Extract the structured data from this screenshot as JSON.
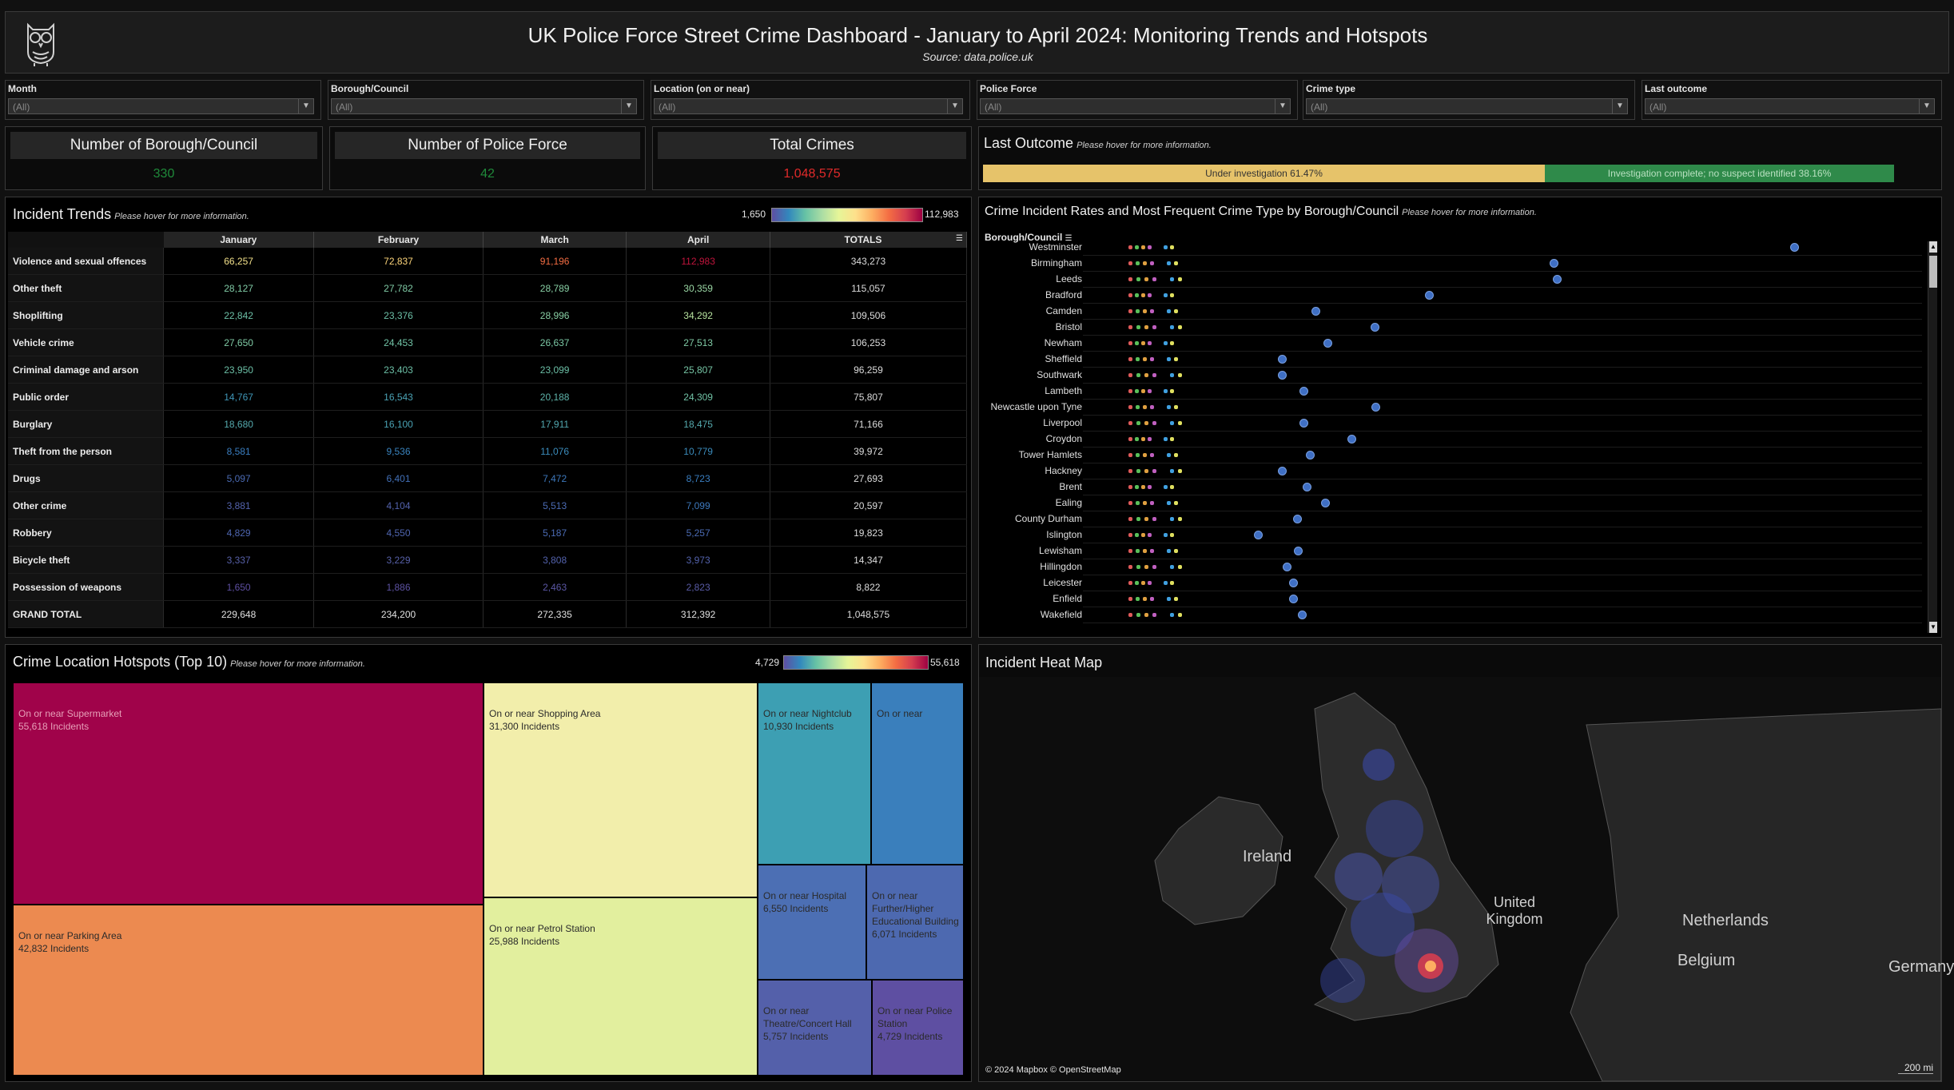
{
  "header": {
    "title": "UK Police Force Street Crime Dashboard - January to April 2024: Monitoring Trends and Hotspots",
    "subtitle": "Source: data.police.uk",
    "logo_icon": "owl-icon"
  },
  "filters": [
    {
      "label": "Month",
      "value": "(All)"
    },
    {
      "label": "Borough/Council",
      "value": "(All)"
    },
    {
      "label": "Location (on or near)",
      "value": "(All)"
    },
    {
      "label": "Police Force",
      "value": "(All)"
    },
    {
      "label": "Crime type",
      "value": "(All)"
    },
    {
      "label": "Last outcome",
      "value": "(All)"
    }
  ],
  "kpis": [
    {
      "label": "Number of Borough/Council",
      "value": "330",
      "color": "#1f8a3a"
    },
    {
      "label": "Number of Police Force",
      "value": "42",
      "color": "#1f8a3a"
    },
    {
      "label": "Total Crimes",
      "value": "1,048,575",
      "color": "#e02a2a"
    }
  ],
  "last_outcome": {
    "title": "Last Outcome",
    "hint": "Please hover for more information.",
    "bars": [
      {
        "label": "Under investigation 61.47%",
        "share": 61.47,
        "color": "#e6c36a"
      },
      {
        "label": "Investigation complete; no suspect identified 38.16%",
        "share": 38.16,
        "color": "#2f8a4a"
      }
    ]
  },
  "incident_trends": {
    "title": "Incident Trends",
    "hint": "Please hover for more information.",
    "legend_min": "1,650",
    "legend_max": "112,983",
    "columns": [
      "January",
      "February",
      "March",
      "April",
      "TOTALS"
    ],
    "rows": [
      {
        "name": "Violence and sexual offences",
        "values": [
          "66,257",
          "72,837",
          "91,196",
          "112,983"
        ],
        "total": "343,273",
        "colors": [
          "#f2e08a",
          "#fdd57a",
          "#f46d43",
          "#c0143c"
        ]
      },
      {
        "name": "Other theft",
        "values": [
          "28,127",
          "27,782",
          "28,789",
          "30,359"
        ],
        "total": "115,057",
        "colors": [
          "#7fcaa5",
          "#7fcaa5",
          "#88cfa4",
          "#9ad7a4"
        ]
      },
      {
        "name": "Shoplifting",
        "values": [
          "22,842",
          "23,376",
          "28,996",
          "34,292"
        ],
        "total": "109,506",
        "colors": [
          "#6cbfa6",
          "#6cbfa6",
          "#88cfa4",
          "#b6e29e"
        ]
      },
      {
        "name": "Vehicle crime",
        "values": [
          "27,650",
          "24,453",
          "26,637",
          "27,513"
        ],
        "total": "106,253",
        "colors": [
          "#7fcaa5",
          "#71c3a6",
          "#7bc8a5",
          "#7fcaa5"
        ]
      },
      {
        "name": "Criminal damage and arson",
        "values": [
          "23,950",
          "23,403",
          "23,099",
          "25,807"
        ],
        "total": "96,259",
        "colors": [
          "#6cbfa6",
          "#6cbfa6",
          "#6cbfa6",
          "#76c5a5"
        ]
      },
      {
        "name": "Public order",
        "values": [
          "14,767",
          "16,543",
          "20,188",
          "24,309"
        ],
        "total": "75,807",
        "colors": [
          "#3f96b7",
          "#4aa2b4",
          "#5eb4aa",
          "#71c3a6"
        ]
      },
      {
        "name": "Burglary",
        "values": [
          "18,680",
          "16,100",
          "17,911",
          "18,475"
        ],
        "total": "71,166",
        "colors": [
          "#55aaae",
          "#4aa2b4",
          "#52a8b0",
          "#55aaae"
        ]
      },
      {
        "name": "Theft from the person",
        "values": [
          "8,581",
          "9,536",
          "11,076",
          "10,779"
        ],
        "total": "39,972",
        "colors": [
          "#3a7ec0",
          "#3a84bf",
          "#3b8cbc",
          "#3b8cbc"
        ]
      },
      {
        "name": "Drugs",
        "values": [
          "5,097",
          "6,401",
          "7,472",
          "8,723"
        ],
        "total": "27,693",
        "colors": [
          "#4b6bb4",
          "#4270b8",
          "#3d78bc",
          "#3a7ec0"
        ]
      },
      {
        "name": "Other crime",
        "values": [
          "3,881",
          "4,104",
          "5,513",
          "7,099"
        ],
        "total": "20,597",
        "colors": [
          "#5362ac",
          "#5362ac",
          "#4b6bb4",
          "#3d78bc"
        ]
      },
      {
        "name": "Robbery",
        "values": [
          "4,829",
          "4,550",
          "5,187",
          "5,257"
        ],
        "total": "19,823",
        "colors": [
          "#4e66b0",
          "#4f65af",
          "#4b6bb4",
          "#4b6bb4"
        ]
      },
      {
        "name": "Bicycle theft",
        "values": [
          "3,337",
          "3,229",
          "3,808",
          "3,973"
        ],
        "total": "14,347",
        "colors": [
          "#5760a8",
          "#5760a8",
          "#5362ac",
          "#5362ac"
        ]
      },
      {
        "name": "Possession of weapons",
        "values": [
          "1,650",
          "1,886",
          "2,463",
          "2,823"
        ],
        "total": "8,822",
        "colors": [
          "#5e4fa2",
          "#5d52a3",
          "#5b57a5",
          "#595ba6"
        ]
      },
      {
        "name": "GRAND TOTAL",
        "values": [
          "229,648",
          "234,200",
          "272,335",
          "312,392"
        ],
        "total": "1,048,575",
        "colors": [
          "#e0e0e0",
          "#e0e0e0",
          "#e0e0e0",
          "#e0e0e0"
        ]
      }
    ]
  },
  "crime_rates": {
    "title": "Crime Incident Rates and Most Frequent Crime Type by Borough/Council",
    "hint": "Please hover for more information.",
    "column_header": "Borough/Council",
    "boroughs": [
      "Westminster",
      "Birmingham",
      "Leeds",
      "Bradford",
      "Camden",
      "Bristol",
      "Newham",
      "Sheffield",
      "Southwark",
      "Lambeth",
      "Newcastle upon Tyne",
      "Liverpool",
      "Croydon",
      "Tower Hamlets",
      "Hackney",
      "Brent",
      "Ealing",
      "County Durham",
      "Islington",
      "Lewisham",
      "Hillingdon",
      "Leicester",
      "Enfield",
      "Wakefield"
    ],
    "max_marker_pos": [
      0.843,
      0.556,
      0.56,
      0.408,
      0.272,
      0.343,
      0.287,
      0.232,
      0.232,
      0.258,
      0.344,
      0.258,
      0.315,
      0.266,
      0.232,
      0.262,
      0.284,
      0.25,
      0.204,
      0.251,
      0.238,
      0.246,
      0.246,
      0.256
    ]
  },
  "hotspots": {
    "title": "Crime Location Hotspots (Top 10)",
    "hint": "Please hover for more information.",
    "legend_min": "4,729",
    "legend_max": "55,618",
    "tiles": [
      {
        "label": "On or near Supermarket",
        "value": "55,618 Incidents",
        "color": "#a0034a"
      },
      {
        "label": "On or near Parking Area",
        "value": "42,832 Incidents",
        "color": "#ec8a50"
      },
      {
        "label": "On or near Shopping Area",
        "value": "31,300 Incidents",
        "color": "#f2eeab"
      },
      {
        "label": "On or near Petrol Station",
        "value": "25,988 Incidents",
        "color": "#e2ef9e"
      },
      {
        "label": "On or near Nightclub",
        "value": "10,930 Incidents",
        "color": "#3d9fb3"
      },
      {
        "label": "On or near",
        "value": "",
        "color": "#3a7fbc"
      },
      {
        "label": "On or near Hospital",
        "value": "6,550 Incidents",
        "color": "#4c6fb4"
      },
      {
        "label": "On or near Further/Higher Educational Building",
        "value": "6,071 Incidents",
        "color": "#4d69b0"
      },
      {
        "label": "On or near Theatre/Concert Hall",
        "value": "5,757 Incidents",
        "color": "#5460aa"
      },
      {
        "label": "On or near Police Station",
        "value": "4,729 Incidents",
        "color": "#5e4fa2"
      }
    ]
  },
  "heat_map": {
    "title": "Incident Heat Map",
    "labels": {
      "ireland": "Ireland",
      "uk": "United Kingdom",
      "netherlands": "Netherlands",
      "belgium": "Belgium",
      "germany": "Germany"
    },
    "attribution": "© 2024 Mapbox © OpenStreetMap",
    "scale": "200 mi"
  }
}
